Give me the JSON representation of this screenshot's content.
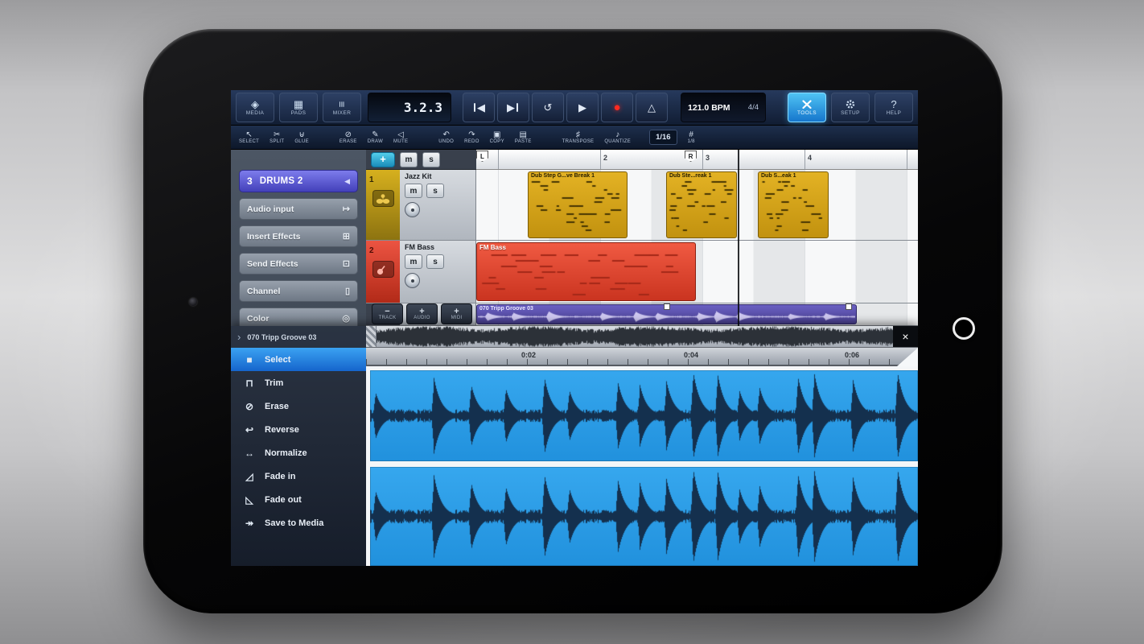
{
  "toolbar": {
    "media": "MEDIA",
    "pads": "PADS",
    "mixer": "MIXER",
    "time_display": "3.2.3",
    "bpm": "121.0 BPM",
    "time_signature": "4/4",
    "tools": "TOOLS",
    "setup": "SETUP",
    "help": "HELP"
  },
  "edit_toolbar": {
    "select": "SELECT",
    "split": "SPLIT",
    "glue": "GLUE",
    "erase": "ERASE",
    "draw": "DRAW",
    "mute": "MUTE",
    "undo": "UNDO",
    "redo": "REDO",
    "copy": "COPY",
    "paste": "PASTE",
    "transpose": "TRANSPOSE",
    "quantize": "QUANTIZE",
    "grid_value": "1/16",
    "snap_value": "1/8"
  },
  "inspector": {
    "track_number": "3",
    "track_name": "DRUMS 2",
    "collapse_arrow": "◀",
    "items": [
      {
        "label": "Audio input"
      },
      {
        "label": "Insert Effects"
      },
      {
        "label": "Send Effects"
      },
      {
        "label": "Channel"
      },
      {
        "label": "Color"
      }
    ]
  },
  "tracks": {
    "mute_label": "m",
    "solo_label": "s",
    "list": [
      {
        "number": "1",
        "name": "Jazz Kit"
      },
      {
        "number": "2",
        "name": "FM Bass"
      }
    ]
  },
  "ruler": {
    "loop_start": "L",
    "loop_end": "R",
    "bars": [
      "2",
      "3",
      "4"
    ]
  },
  "clips": {
    "midi": [
      {
        "title": "Dub Step G...ve Break 1"
      },
      {
        "title": "Dub Ste...reak 1"
      },
      {
        "title": "Dub S...eak 1"
      }
    ],
    "audio": {
      "title": "FM Bass"
    },
    "wave": {
      "title": "070 Tripp Groove 03"
    }
  },
  "add_buttons": {
    "track": "TRACK",
    "audio": "AUDIO",
    "midi": "MIDI",
    "minus": "−",
    "plus": "+"
  },
  "editor": {
    "title": "070 Tripp Groove 03",
    "chevron": "›",
    "close": "×",
    "times": [
      "0:02",
      "0:04",
      "0:06"
    ],
    "tools": [
      {
        "label": "Select"
      },
      {
        "label": "Trim"
      },
      {
        "label": "Erase"
      },
      {
        "label": "Reverse"
      },
      {
        "label": "Normalize"
      },
      {
        "label": "Fade in"
      },
      {
        "label": "Fade out"
      },
      {
        "label": "Save to Media"
      }
    ]
  },
  "icons": {
    "media": "◈",
    "pads": "▦",
    "mixer": "≡",
    "rewind": "◀",
    "forward": "▶",
    "loop": "↺",
    "play": "▶",
    "record": "●",
    "metronome": "△",
    "help": "?",
    "select_tool": "↖",
    "split_tool": "✂",
    "glue_tool": "⊎",
    "erase_tool": "⊘",
    "draw_tool": "✎",
    "mute_tool": "◁",
    "undo": "↶",
    "redo": "↷",
    "copy": "▣",
    "paste": "▤",
    "transpose": "♯",
    "quantize": "♪",
    "grid": "#",
    "audio_input": "↦",
    "insert_effects": "⊞",
    "send_effects": "⊡",
    "channel": "▯",
    "color": "◎",
    "crosshair": "+",
    "tool_select": "■",
    "tool_trim": "⊓",
    "tool_erase": "⊘",
    "tool_reverse": "↩",
    "tool_normalize": "↔",
    "tool_fade_in": "◿",
    "tool_fade_out": "◺",
    "tool_save": "↠"
  },
  "colors": {
    "accent": "#2aa4e8",
    "midi_clip": "#d9a51e",
    "audio_clip": "#e8492e",
    "wave_clip": "#5b51ab",
    "wave_bg": "#2b9fe8",
    "wave_stroke": "#14304e"
  }
}
